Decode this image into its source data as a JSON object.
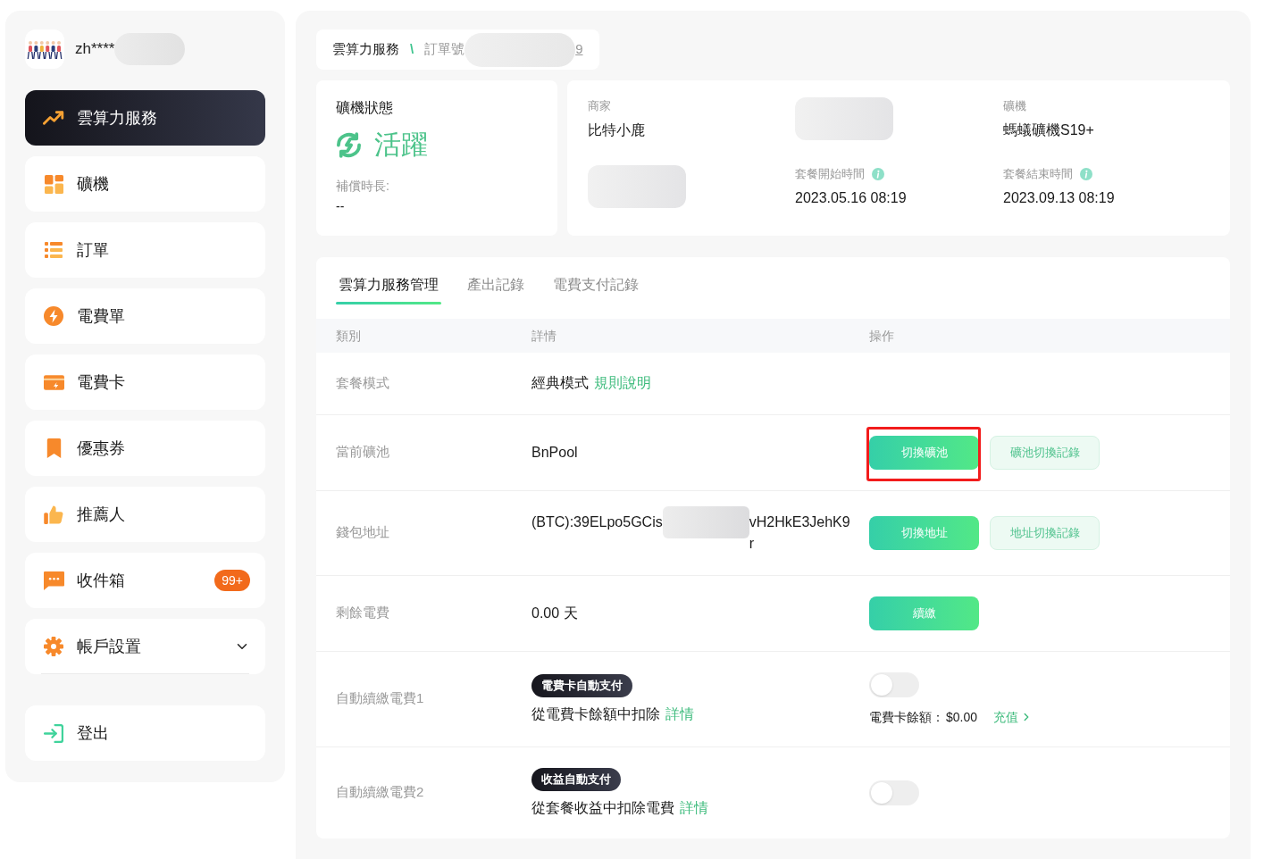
{
  "sidebar": {
    "user": {
      "name": "zh****"
    },
    "items": [
      {
        "label": "雲算力服務",
        "selected": true,
        "kind": "link"
      },
      {
        "label": "礦機",
        "selected": false,
        "kind": "link"
      },
      {
        "label": "訂單",
        "selected": false,
        "kind": "link"
      },
      {
        "label": "電費單",
        "selected": false,
        "kind": "link"
      },
      {
        "label": "電費卡",
        "selected": false,
        "kind": "link"
      },
      {
        "label": "優惠券",
        "selected": false,
        "kind": "link"
      },
      {
        "label": "推薦人",
        "selected": false,
        "kind": "link"
      },
      {
        "label": "收件箱",
        "selected": false,
        "kind": "link",
        "badge": "99+"
      },
      {
        "label": "帳戶設置",
        "selected": false,
        "kind": "group",
        "expanded": false
      }
    ],
    "logout": {
      "label": "登出"
    }
  },
  "breadcrumb": {
    "items": [
      "雲算力服務",
      "訂單號"
    ],
    "separator": "\\",
    "tail": "9"
  },
  "status_card": {
    "title": "礦機狀態",
    "status": "活躍",
    "compensation_label": "補償時長:",
    "compensation_value": "--"
  },
  "info_card": {
    "fields": [
      {
        "kind": "text",
        "label": "商家",
        "value": "比特小鹿",
        "hint": false
      },
      {
        "kind": "redacted"
      },
      {
        "kind": "text",
        "label": "礦機",
        "value": "螞蟻礦機S19+",
        "hint": false
      },
      {
        "kind": "redacted"
      },
      {
        "kind": "text",
        "label": "套餐開始時間",
        "value": "2023.05.16 08:19",
        "hint": true
      },
      {
        "kind": "text",
        "label": "套餐結束時間",
        "value": "2023.09.13 08:19",
        "hint": true
      }
    ]
  },
  "tabs": [
    {
      "label": "雲算力服務管理",
      "selected": true
    },
    {
      "label": "產出記錄",
      "selected": false
    },
    {
      "label": "電費支付記錄",
      "selected": false
    }
  ],
  "table": {
    "columns": [
      "類別",
      "詳情",
      "操作"
    ],
    "rows": [
      {
        "category": "套餐模式",
        "detail": {
          "kind": "text",
          "text": "經典模式",
          "link": "規則說明"
        }
      },
      {
        "category": "當前礦池",
        "detail": {
          "kind": "text",
          "text": "BnPool"
        },
        "actions": [
          {
            "kind": "primary",
            "label": "切換礦池",
            "highlighted": true
          },
          {
            "kind": "secondary",
            "label": "礦池切換記錄",
            "highlighted": false
          }
        ]
      },
      {
        "category": "錢包地址",
        "detail": {
          "kind": "redacted",
          "text": "(BTC):39ELpo5GCis",
          "text_after": "vH2HkE3JehK9r"
        },
        "actions": [
          {
            "kind": "primary",
            "label": "切換地址",
            "highlighted": false
          },
          {
            "kind": "secondary",
            "label": "地址切換記錄",
            "highlighted": false
          }
        ]
      },
      {
        "category": "剩餘電費",
        "detail": {
          "kind": "text",
          "text": "0.00 天"
        },
        "actions": [
          {
            "kind": "primary",
            "label": "續繳",
            "highlighted": false
          }
        ]
      },
      {
        "category": "自動續繳電費1",
        "detail": {
          "kind": "text",
          "badge": "電費卡自動支付",
          "text": "從電費卡餘額中扣除",
          "link": "詳情"
        },
        "actions": [
          {
            "kind": "toggle",
            "on": false
          },
          {
            "kind": "balance",
            "label": "電費卡餘額：",
            "value": "$0.00",
            "link": "充值"
          }
        ]
      },
      {
        "category": "自動續繳電費2",
        "detail": {
          "kind": "text",
          "badge": "收益自動支付",
          "text": "從套餐收益中扣除電費",
          "link": "詳情"
        },
        "actions": [
          {
            "kind": "toggle",
            "on": false
          }
        ]
      }
    ]
  }
}
